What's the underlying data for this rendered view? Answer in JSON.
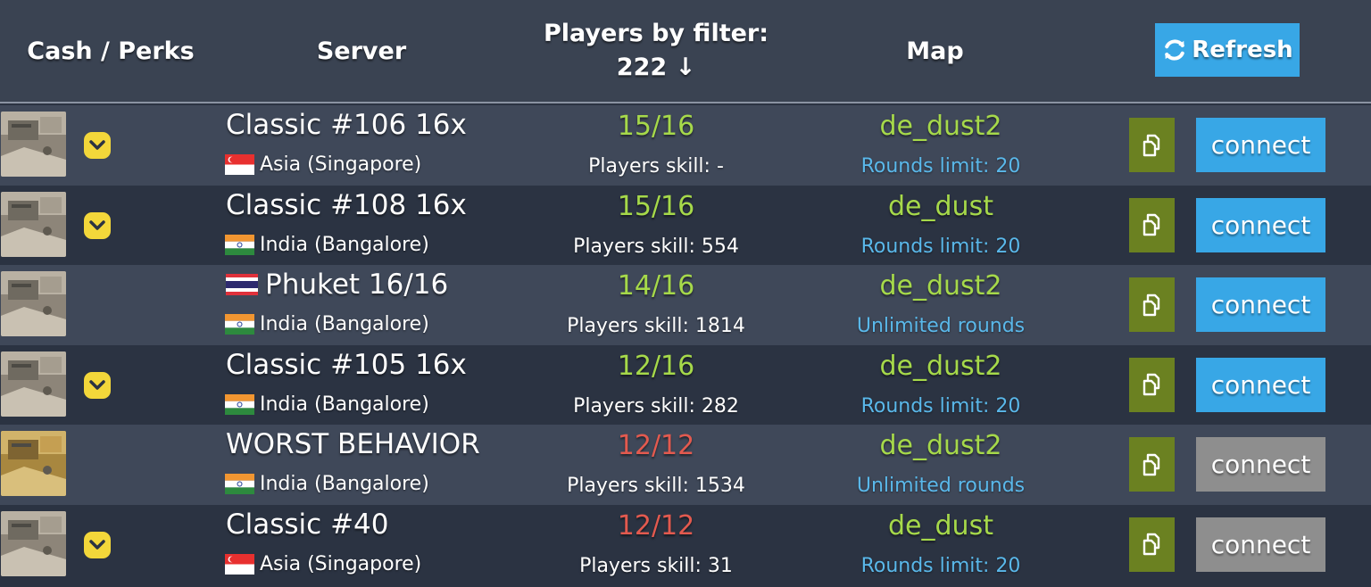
{
  "header": {
    "cash_perks": "Cash / Perks",
    "server": "Server",
    "players_by_filter": "Players by filter:",
    "players_total": "222",
    "sort_arrow": "↓",
    "map": "Map",
    "refresh": "Refresh"
  },
  "colors": {
    "header_bg": "#3a4352",
    "row_odd": "#2b3342",
    "row_even": "#3f4859",
    "accent_blue": "#38a7e6",
    "player_count_open": "#a6d94a",
    "player_count_full": "#e35a4f",
    "map_name": "#a6d94a",
    "rounds_text": "#5ab8ea",
    "copy_button": "#6b8121",
    "connect_disabled": "#8e8e8e",
    "perk_yellow": "#f3d73a"
  },
  "rows": [
    {
      "name": "Classic #106 16x",
      "flag": "singapore-flag",
      "location": "Asia (Singapore)",
      "players": "15",
      "slots": "16",
      "full": false,
      "skill": "Players skill: -",
      "map": "de_dust2",
      "rounds": "Rounds limit: 20",
      "perk": true,
      "copy_icon": "copy-icon",
      "connect": "connect",
      "connect_enabled": true,
      "thumb_variant": "grey"
    },
    {
      "name": "Classic #108 16x",
      "flag": "india-flag",
      "location": "India (Bangalore)",
      "players": "15",
      "slots": "16",
      "full": false,
      "skill": "Players skill: 554",
      "map": "de_dust",
      "rounds": "Rounds limit: 20",
      "perk": true,
      "copy_icon": "copy-icon",
      "connect": "connect",
      "connect_enabled": true,
      "thumb_variant": "grey"
    },
    {
      "name": "Phuket 16/16",
      "name_flag": "thailand-flag",
      "flag": "india-flag",
      "location": "India (Bangalore)",
      "players": "14",
      "slots": "16",
      "full": false,
      "skill": "Players skill: 1814",
      "map": "de_dust2",
      "rounds": "Unlimited rounds",
      "perk": false,
      "copy_icon": "copy-icon",
      "connect": "connect",
      "connect_enabled": true,
      "thumb_variant": "grey"
    },
    {
      "name": "Classic #105 16x",
      "flag": "india-flag",
      "location": "India (Bangalore)",
      "players": "12",
      "slots": "16",
      "full": false,
      "skill": "Players skill: 282",
      "map": "de_dust2",
      "rounds": "Rounds limit: 20",
      "perk": true,
      "copy_icon": "copy-icon",
      "connect": "connect",
      "connect_enabled": true,
      "thumb_variant": "grey"
    },
    {
      "name": "WORST BEHAVIOR",
      "flag": "india-flag",
      "location": "India (Bangalore)",
      "players": "12",
      "slots": "12",
      "full": true,
      "skill": "Players skill: 1534",
      "map": "de_dust2",
      "rounds": "Unlimited rounds",
      "perk": false,
      "copy_icon": "copy-icon",
      "connect": "connect",
      "connect_enabled": false,
      "thumb_variant": "golden"
    },
    {
      "name": "Classic #40",
      "flag": "singapore-flag",
      "location": "Asia (Singapore)",
      "players": "12",
      "slots": "12",
      "full": true,
      "skill": "Players skill: 31",
      "map": "de_dust",
      "rounds": "Rounds limit: 20",
      "perk": true,
      "copy_icon": "copy-icon",
      "connect": "connect",
      "connect_enabled": false,
      "thumb_variant": "grey"
    }
  ]
}
